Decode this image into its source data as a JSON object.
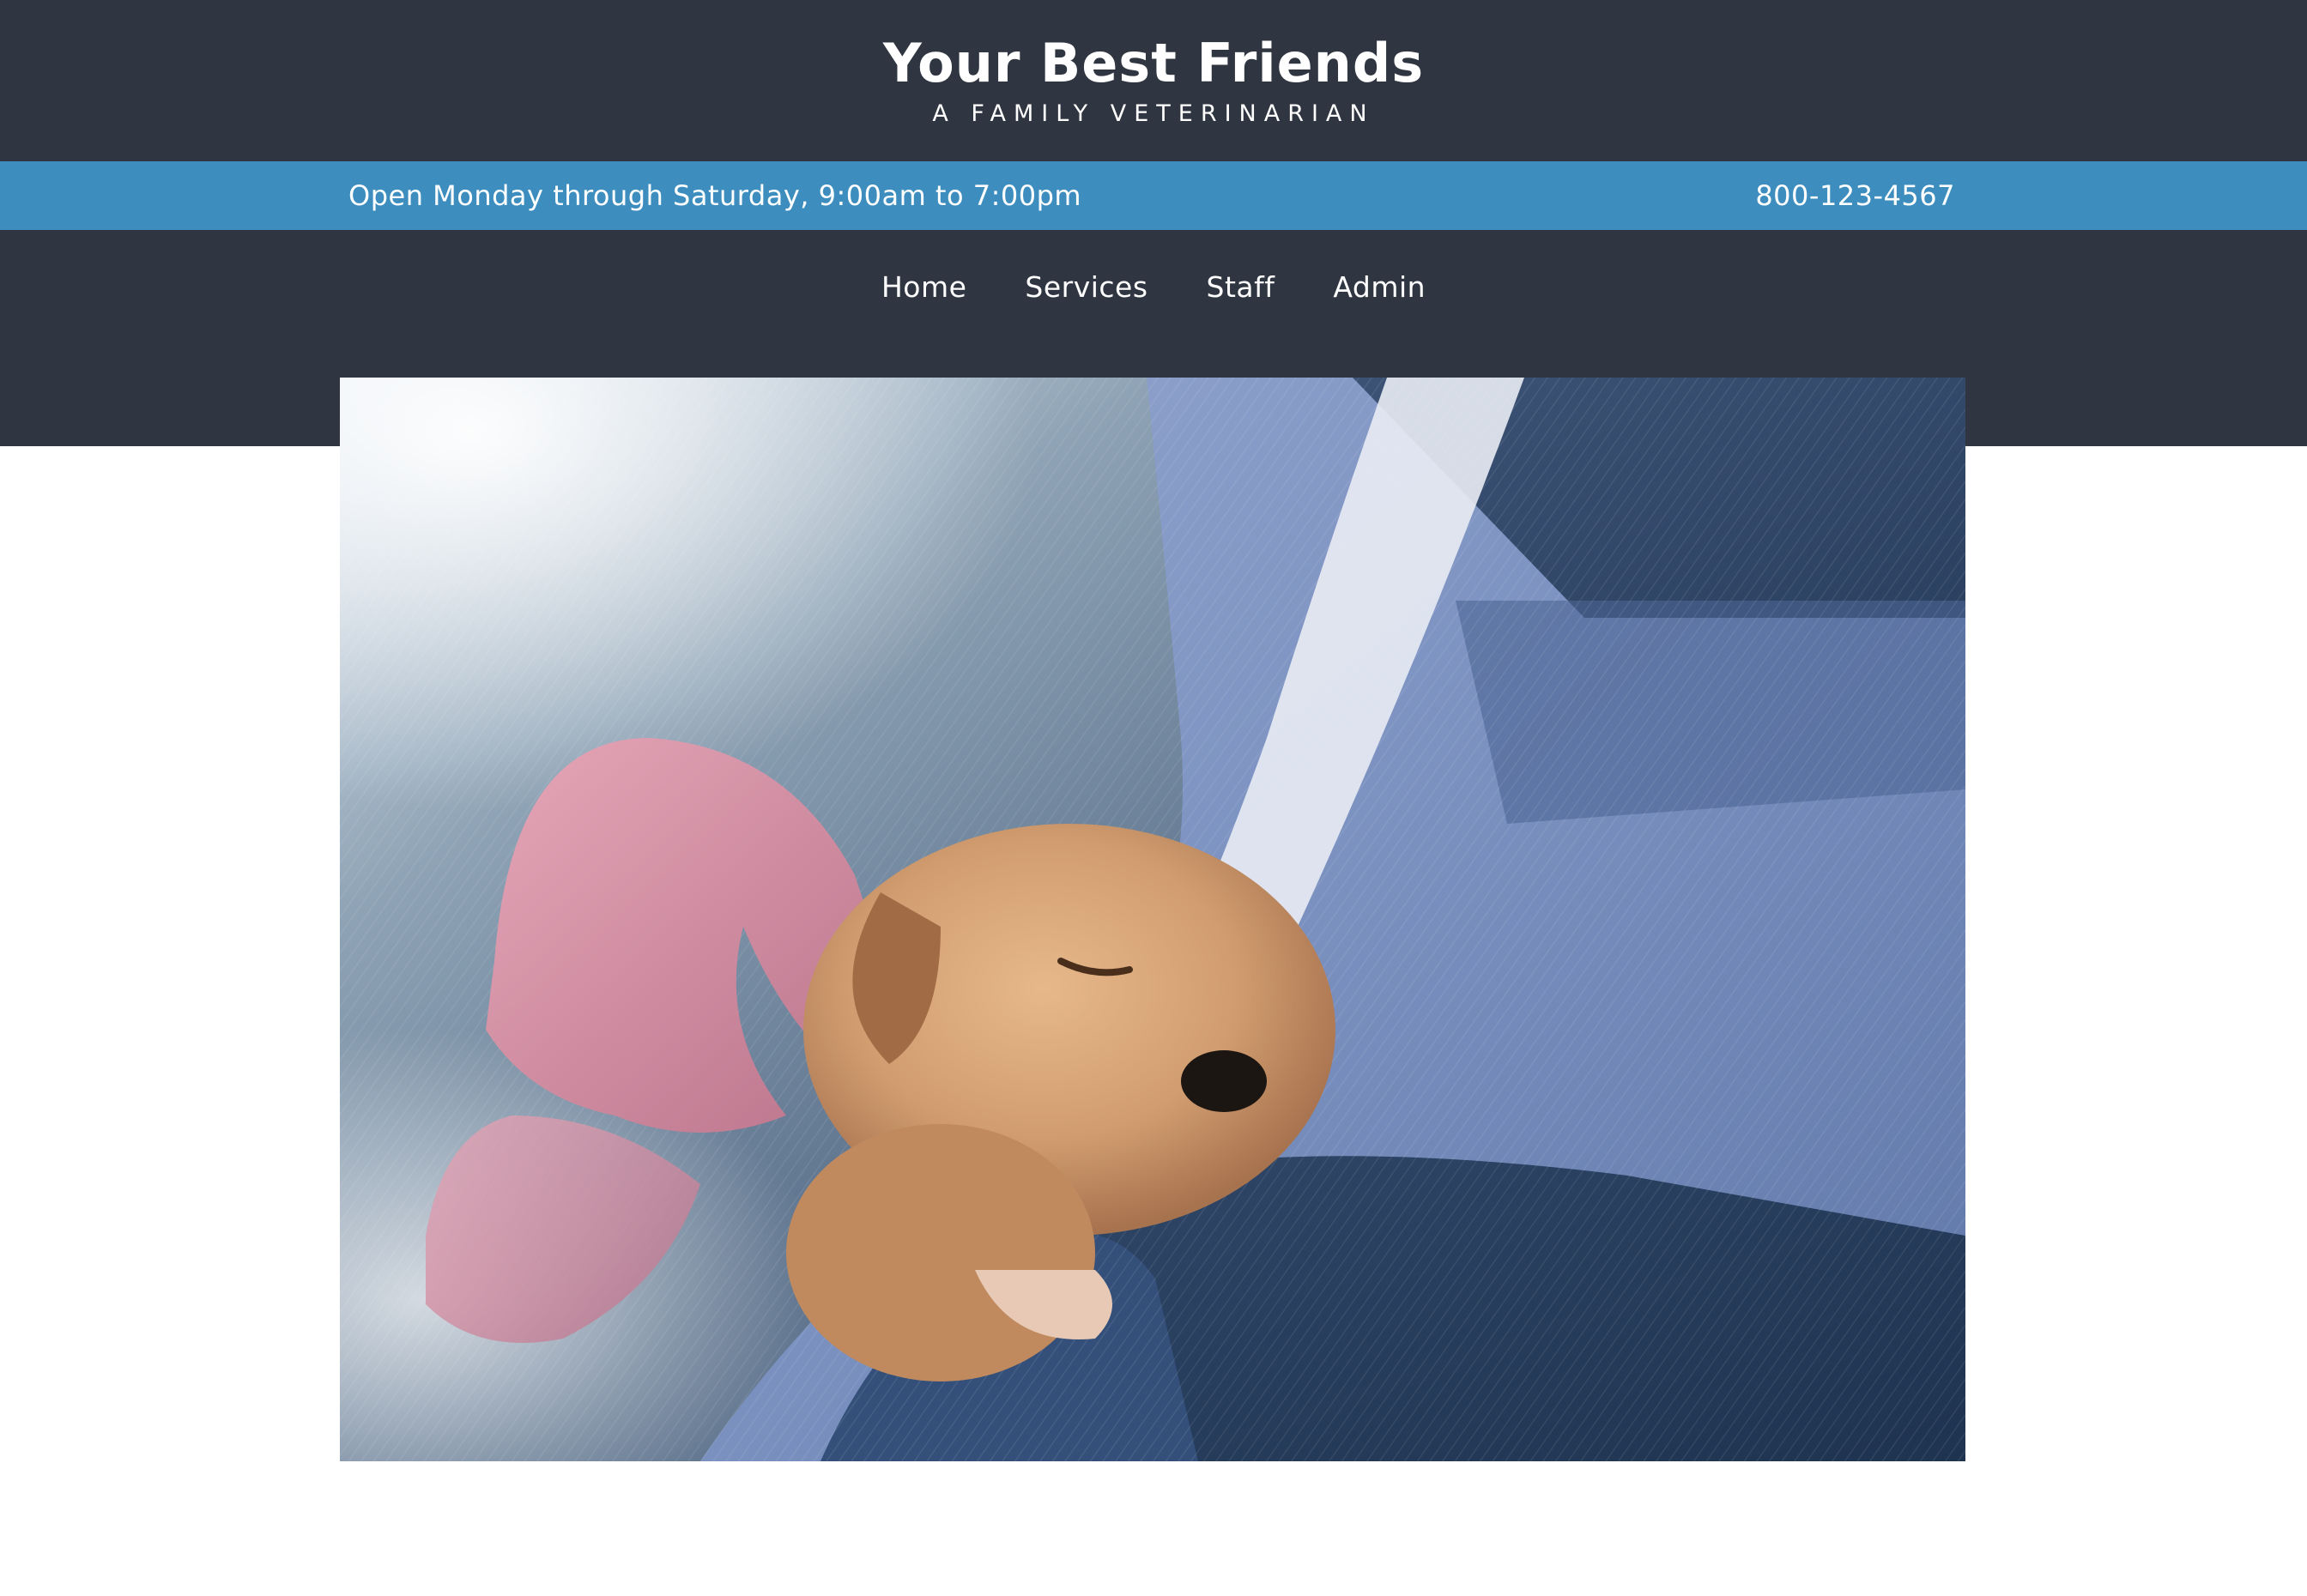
{
  "header": {
    "site_title": "Your Best Friends",
    "tagline": "A FAMILY VETERINARIAN"
  },
  "info_bar": {
    "hours": "Open Monday through Saturday, 9:00am to 7:00pm",
    "phone": "800-123-4567"
  },
  "nav": {
    "items": [
      {
        "label": "Home"
      },
      {
        "label": "Services"
      },
      {
        "label": "Staff"
      },
      {
        "label": "Admin"
      }
    ]
  },
  "hero": {
    "image_alt": "puppy-held-in-arms-photo"
  },
  "colors": {
    "header_bg": "#303641",
    "info_bar_bg": "#3d8ebf",
    "text": "#ffffff",
    "page_bg": "#ffffff"
  }
}
